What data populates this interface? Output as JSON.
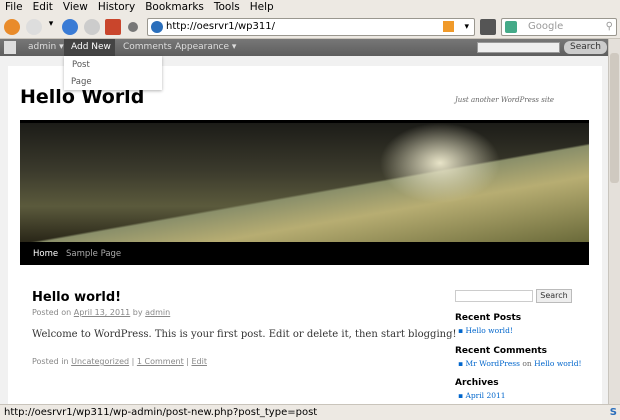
{
  "browser": {
    "menu": [
      "File",
      "Edit",
      "View",
      "History",
      "Bookmarks",
      "Tools",
      "Help"
    ],
    "url": "http://oesrvr1/wp311/",
    "search_placeholder": "Google",
    "status": "http://oesrvr1/wp311/wp-admin/post-new.php?post_type=post"
  },
  "adminbar": {
    "items": [
      "admin",
      "Add New",
      "Comments",
      "Appearance"
    ],
    "search_label": "Search",
    "dropdown": [
      "Post",
      "Page"
    ]
  },
  "site": {
    "title": "Hello World",
    "tagline": "Just another WordPress site",
    "nav": [
      "Home",
      "Sample Page"
    ]
  },
  "post": {
    "title": "Hello world!",
    "posted_on": "Posted on",
    "date": "April 13, 2011",
    "by": "by",
    "author": "admin",
    "content": "Welcome to WordPress. This is your first post. Edit or delete it, then start blogging!",
    "posted_in": "Posted in",
    "category": "Uncategorized",
    "comments": "1 Comment",
    "edit": "Edit"
  },
  "sidebar": {
    "search_label": "Search",
    "recent_posts_title": "Recent Posts",
    "recent_posts": [
      "Hello world!"
    ],
    "recent_comments_title": "Recent Comments",
    "comment_author": "Mr WordPress",
    "comment_on": "on",
    "comment_post": "Hello world!",
    "archives_title": "Archives",
    "archives": [
      "April 2011"
    ]
  }
}
